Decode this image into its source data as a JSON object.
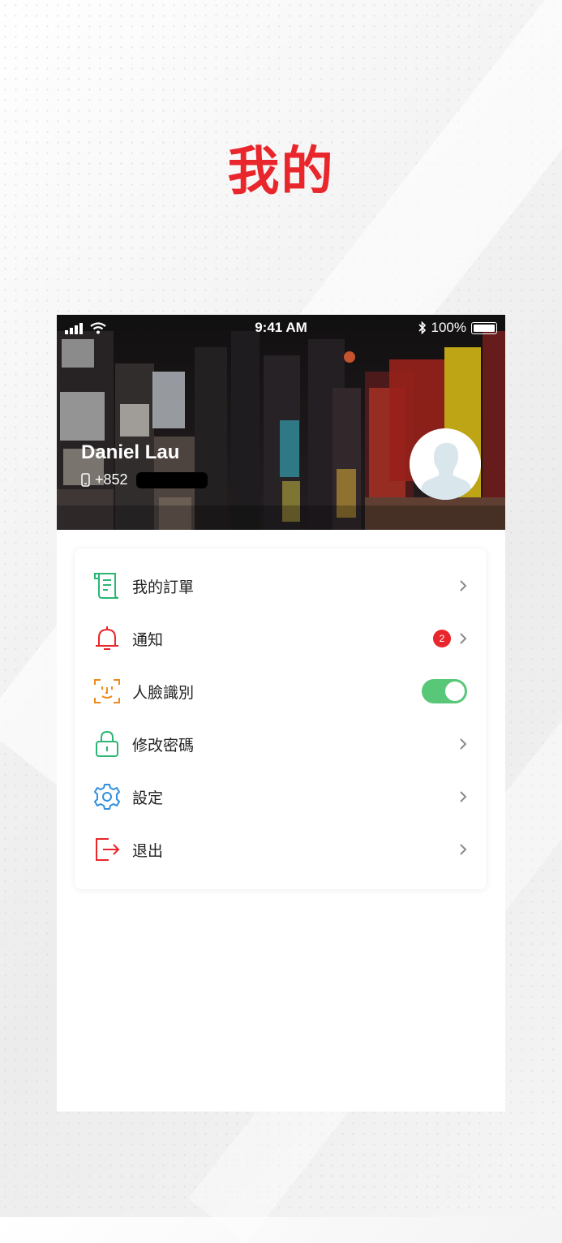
{
  "page": {
    "title": "我的"
  },
  "status_bar": {
    "time": "9:41 AM",
    "battery": "100%"
  },
  "profile": {
    "name": "Daniel Lau",
    "phone_prefix": "+852"
  },
  "menu": {
    "items": [
      {
        "label": "我的訂單",
        "icon": "order-list-icon",
        "color": "#2bb673"
      },
      {
        "label": "通知",
        "icon": "bell-icon",
        "color": "#e8262b",
        "badge": "2"
      },
      {
        "label": "人臉識別",
        "icon": "face-scan-icon",
        "color": "#f08a1c",
        "toggle": "on"
      },
      {
        "label": "修改密碼",
        "icon": "lock-icon",
        "color": "#2bb673"
      },
      {
        "label": "設定",
        "icon": "gear-icon",
        "color": "#2f8fe0"
      },
      {
        "label": "退出",
        "icon": "logout-icon",
        "color": "#e8262b"
      }
    ]
  },
  "colors": {
    "accent": "#e8262b",
    "toggle_on": "#58c878"
  }
}
